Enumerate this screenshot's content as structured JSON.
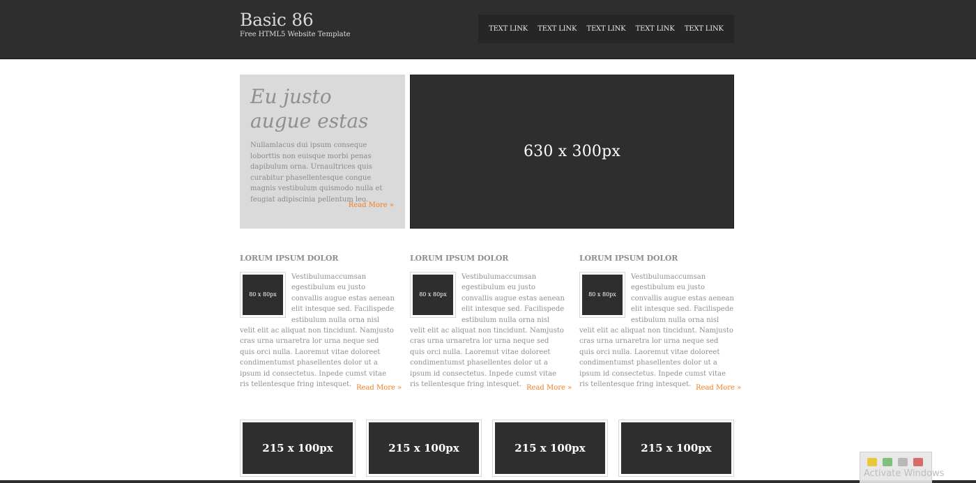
{
  "header": {
    "title": "Basic 86",
    "tagline": "Free HTML5 Website Template",
    "nav": [
      "TEXT LINK",
      "TEXT LINK",
      "TEXT LINK",
      "TEXT LINK",
      "TEXT LINK"
    ]
  },
  "feature": {
    "title": "Eu justo augue estas",
    "text": "Nullamlacus dui ipsum conseque loborttis non euisque morbi penas dapibulum orna. Urnaultrices quis curabitur phasellentesque congue magnis vestibulum quismodo nulla et feugiat adipiscinia pellentum leo.",
    "read_more": "Read More »"
  },
  "hero": {
    "label": "630 x 300px"
  },
  "columns": [
    {
      "heading": "LORUM IPSUM DOLOR",
      "thumb": "80 x 80px",
      "text": "Vestibulumaccumsan egestibulum eu justo convallis augue estas aenean elit intesque sed. Facilispede estibulum nulla orna nisl velit elit ac aliquat non tincidunt. Namjusto cras urna urnaretra lor urna neque sed quis orci nulla. Laoremut vitae doloreet condimentumst phasellentes dolor ut a ipsum id consectetus. Inpede cumst vitae ris tellentesque fring intesquet.",
      "read_more": "Read More »"
    },
    {
      "heading": "LORUM IPSUM DOLOR",
      "thumb": "80 x 80px",
      "text": "Vestibulumaccumsan egestibulum eu justo convallis augue estas aenean elit intesque sed. Facilispede estibulum nulla orna nisl velit elit ac aliquat non tincidunt. Namjusto cras urna urnaretra lor urna neque sed quis orci nulla. Laoremut vitae doloreet condimentumst phasellentes dolor ut a ipsum id consectetus. Inpede cumst vitae ris tellentesque fring intesquet.",
      "read_more": "Read More »"
    },
    {
      "heading": "LORUM IPSUM DOLOR",
      "thumb": "80 x 80px",
      "text": "Vestibulumaccumsan egestibulum eu justo convallis augue estas aenean elit intesque sed. Facilispede estibulum nulla orna nisl velit elit ac aliquat non tincidunt. Namjusto cras urna urnaretra lor urna neque sed quis orci nulla. Laoremut vitae doloreet condimentumst phasellentes dolor ut a ipsum id consectetus. Inpede cumst vitae ris tellentesque fring intesquet.",
      "read_more": "Read More »"
    }
  ],
  "tiles": [
    "215 x 100px",
    "215 x 100px",
    "215 x 100px",
    "215 x 100px"
  ],
  "overlay": {
    "text": "Activate Windows"
  },
  "colors": {
    "header_bg": "#2e2e2e",
    "accent": "#f07f23",
    "feature_bg": "#dadada",
    "text": "#999999"
  }
}
